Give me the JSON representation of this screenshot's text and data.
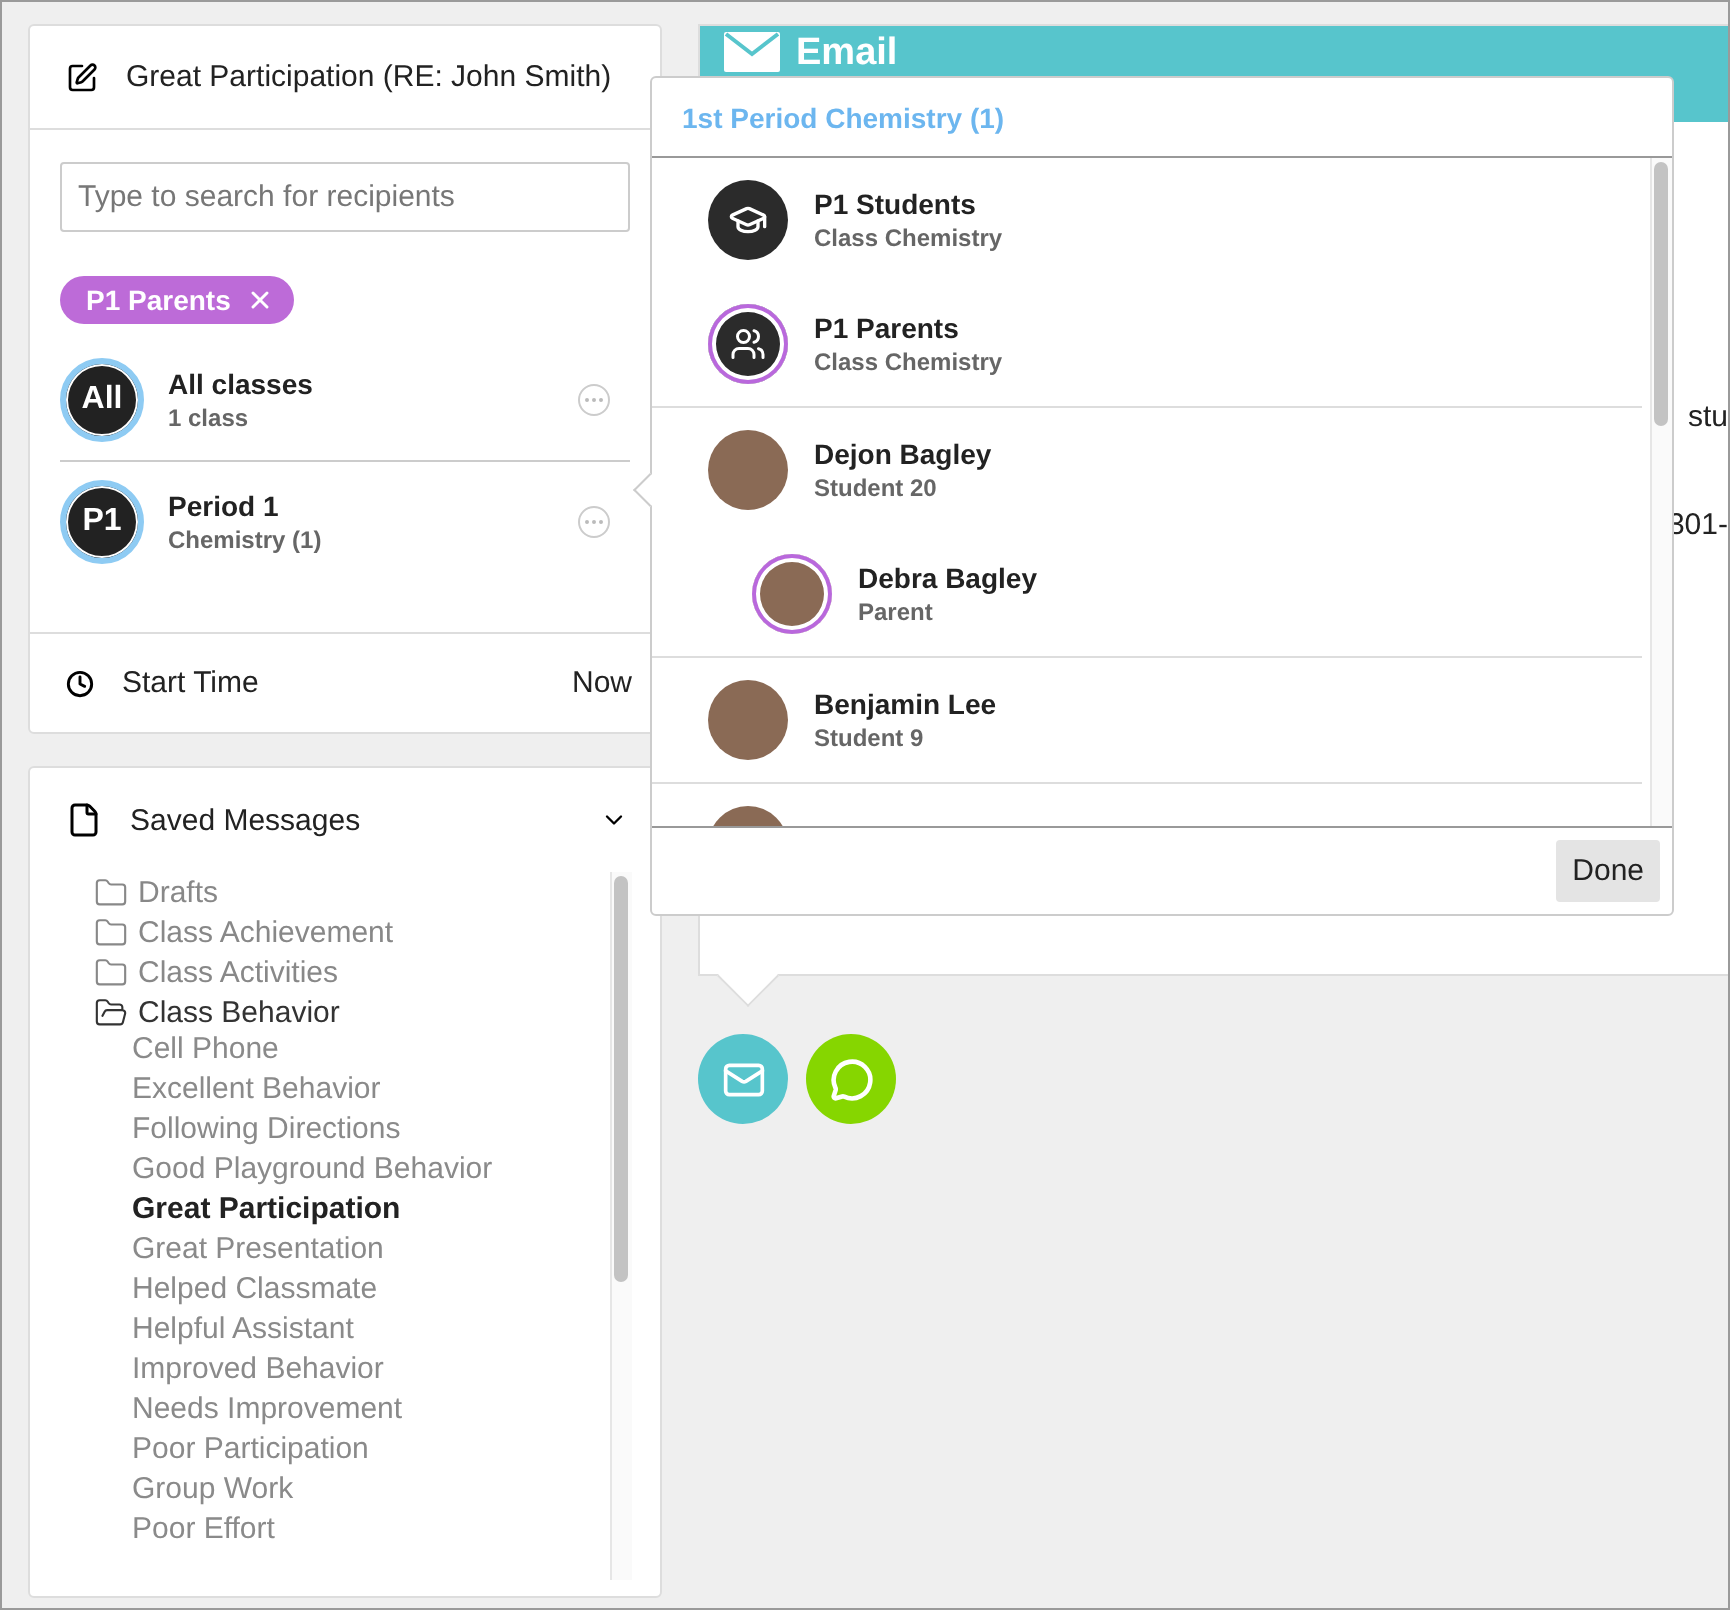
{
  "compose": {
    "title": "Great Participation (RE: John Smith)",
    "search": {
      "placeholder": "Type to search for recipients"
    },
    "chips": [
      {
        "label": "P1 Parents"
      }
    ],
    "classes": [
      {
        "badge": "All",
        "name": "All classes",
        "detail": "1 class"
      },
      {
        "badge": "P1",
        "name": "Period 1",
        "detail": "Chemistry (1)"
      }
    ],
    "start_time": {
      "label": "Start Time",
      "value": "Now"
    }
  },
  "saved_messages": {
    "title": "Saved Messages",
    "items": [
      {
        "kind": "folder",
        "label": "Drafts",
        "expanded": false
      },
      {
        "kind": "folder",
        "label": "Class Achievement",
        "expanded": false
      },
      {
        "kind": "folder",
        "label": "Class Activities",
        "expanded": false
      },
      {
        "kind": "folder",
        "label": "Class Behavior",
        "expanded": true,
        "children": [
          {
            "label": "Cell Phone",
            "selected": false
          },
          {
            "label": "Excellent Behavior",
            "selected": false
          },
          {
            "label": "Following Directions",
            "selected": false
          },
          {
            "label": "Good Playground Behavior",
            "selected": false
          },
          {
            "label": "Great Participation",
            "selected": true
          },
          {
            "label": "Great Presentation",
            "selected": false
          },
          {
            "label": "Helped Classmate",
            "selected": false
          },
          {
            "label": "Helpful Assistant",
            "selected": false
          },
          {
            "label": "Improved Behavior",
            "selected": false
          },
          {
            "label": "Needs Improvement",
            "selected": false
          },
          {
            "label": "Poor Participation",
            "selected": false
          },
          {
            "label": "Group Work",
            "selected": false
          },
          {
            "label": "Poor Effort",
            "selected": false
          }
        ]
      }
    ]
  },
  "email_panel": {
    "title": "Email",
    "fragments": [
      "stu",
      "301-"
    ]
  },
  "channels": [
    {
      "kind": "email"
    },
    {
      "kind": "text"
    }
  ],
  "popover": {
    "title": "1st Period Chemistry (1)",
    "sections": [
      {
        "entries": [
          {
            "kind": "students",
            "name": "P1 Students",
            "detail": "Class Chemistry",
            "selected": false
          },
          {
            "kind": "parents",
            "name": "P1 Parents",
            "detail": "Class Chemistry",
            "selected": true
          }
        ]
      },
      {
        "entries": [
          {
            "kind": "person",
            "name": "Dejon Bagley",
            "detail": "Student 20",
            "selected": false,
            "children": [
              {
                "kind": "person",
                "name": "Debra Bagley",
                "detail": "Parent",
                "selected": true
              }
            ]
          }
        ]
      },
      {
        "entries": [
          {
            "kind": "person",
            "name": "Benjamin Lee",
            "detail": "Student 9",
            "selected": false
          }
        ]
      },
      {
        "entries": [
          {
            "kind": "person",
            "selected": false
          }
        ]
      }
    ],
    "button": "Done"
  }
}
